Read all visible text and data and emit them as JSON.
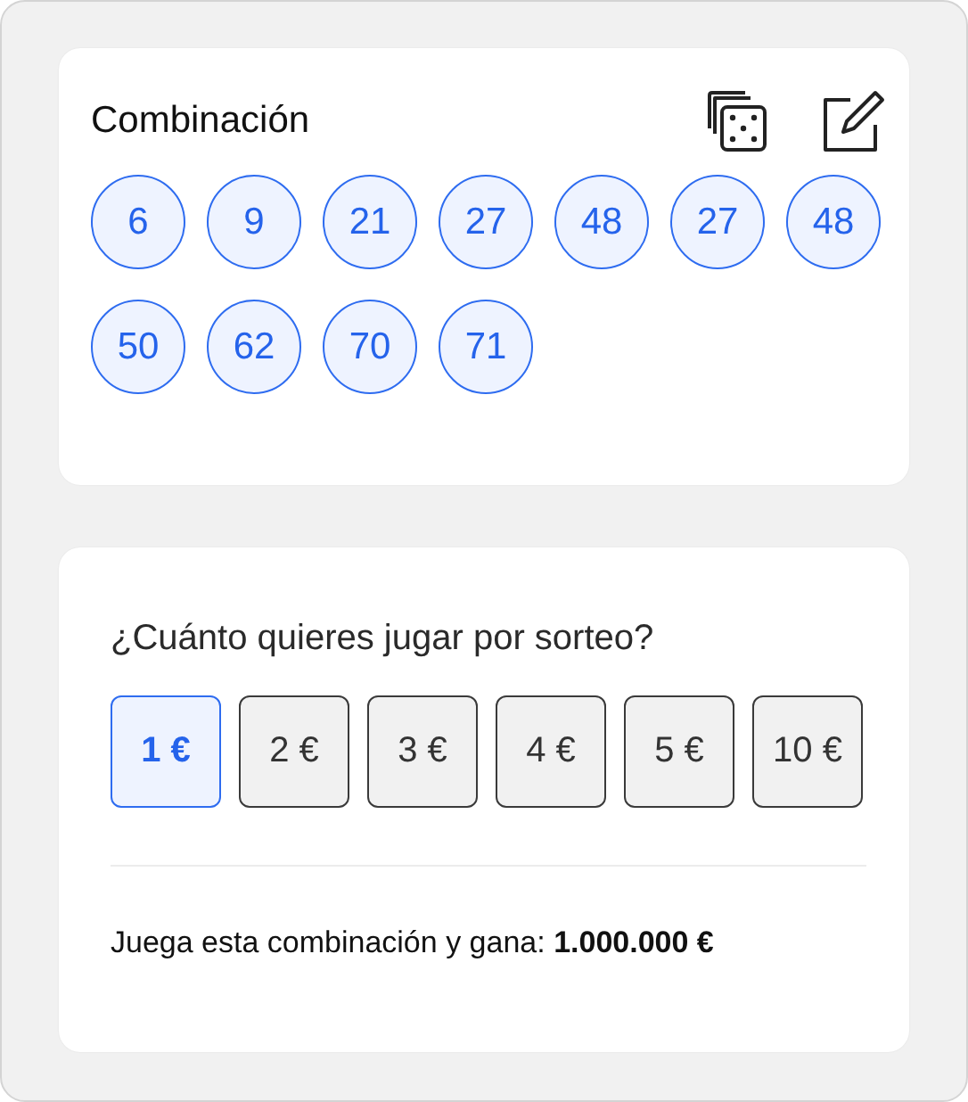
{
  "combination": {
    "title": "Combinación",
    "numbers": [
      "6",
      "9",
      "21",
      "27",
      "48",
      "27",
      "48",
      "50",
      "62",
      "70",
      "71"
    ]
  },
  "stake": {
    "question": "¿Cuánto quieres jugar por sorteo?",
    "options": [
      {
        "label": "1 €",
        "selected": true
      },
      {
        "label": "2 €",
        "selected": false
      },
      {
        "label": "3 €",
        "selected": false
      },
      {
        "label": "4 €",
        "selected": false
      },
      {
        "label": "5 €",
        "selected": false
      },
      {
        "label": "10 €",
        "selected": false
      }
    ],
    "prize": "Juega esta combinación y gana: **1.000.000 €**"
  }
}
